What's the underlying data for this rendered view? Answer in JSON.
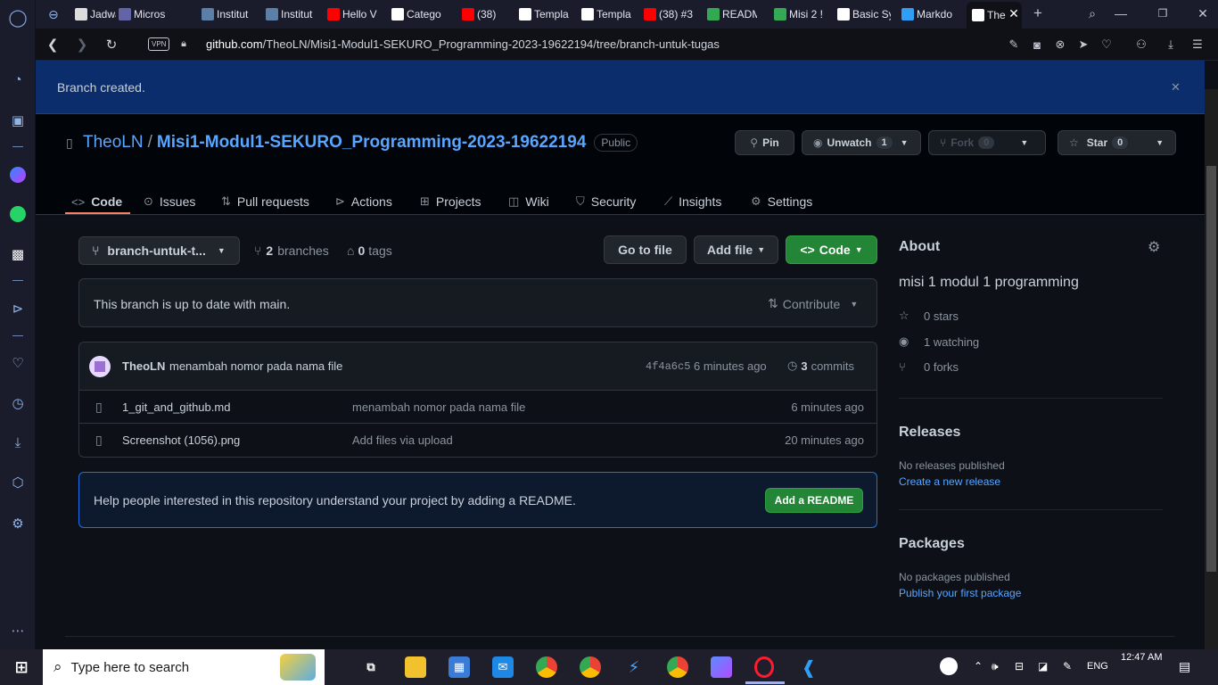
{
  "browser": {
    "tabs": [
      {
        "label": "Jadwal",
        "favicon": "notebook-icon"
      },
      {
        "label": "Micros",
        "favicon": "teams-icon"
      },
      {
        "label": "Institut",
        "favicon": "tableau-icon"
      },
      {
        "label": "Institut",
        "favicon": "tableau-icon"
      },
      {
        "label": "Hello V",
        "favicon": "youtube-icon"
      },
      {
        "label": "Catego",
        "favicon": "s-icon"
      },
      {
        "label": "(38)",
        "favicon": "youtube-icon"
      },
      {
        "label": "Templa",
        "favicon": "github-icon"
      },
      {
        "label": "Templa",
        "favicon": "github-icon"
      },
      {
        "label": "(38) #3",
        "favicon": "youtube-icon"
      },
      {
        "label": "READM",
        "favicon": "drive-icon"
      },
      {
        "label": "Misi 2 !",
        "favicon": "drive-icon"
      },
      {
        "label": "Basic Sy",
        "favicon": "md-icon"
      },
      {
        "label": "Markdo",
        "favicon": "vscode-icon"
      },
      {
        "label": "The",
        "favicon": "github-icon"
      }
    ],
    "vpn_label": "VPN",
    "url_host": "github.com",
    "url_path": "/TheoLN/Misi1-Modul1-SEKURO_Programming-2023-19622194/tree/branch-untuk-tugas"
  },
  "flash": {
    "text": "Branch created."
  },
  "repo": {
    "owner": "TheoLN",
    "separator": "/",
    "name": "Misi1-Modul1-SEKURO_Programming-2023-19622194",
    "visibility": "Public",
    "pin_label": "Pin",
    "unwatch_label": "Unwatch",
    "watch_count": "1",
    "fork_label": "Fork",
    "fork_count": "0",
    "star_label": "Star",
    "star_count": "0"
  },
  "reponav": [
    {
      "label": "Code",
      "icon": "code-icon"
    },
    {
      "label": "Issues",
      "icon": "issue-icon"
    },
    {
      "label": "Pull requests",
      "icon": "pull-request-icon"
    },
    {
      "label": "Actions",
      "icon": "play-icon"
    },
    {
      "label": "Projects",
      "icon": "table-icon"
    },
    {
      "label": "Wiki",
      "icon": "book-icon"
    },
    {
      "label": "Security",
      "icon": "shield-icon"
    },
    {
      "label": "Insights",
      "icon": "graph-icon"
    },
    {
      "label": "Settings",
      "icon": "gear-icon"
    }
  ],
  "toolbar": {
    "branch": "branch-untuk-t...",
    "branches_count": "2",
    "branches_label": "branches",
    "tags_count": "0",
    "tags_label": "tags",
    "go_to_file": "Go to file",
    "add_file": "Add file",
    "code": "Code"
  },
  "branch_status": {
    "text": "This branch is up to date with main.",
    "contribute": "Contribute"
  },
  "latest_commit": {
    "author": "TheoLN",
    "message": "menambah nomor pada nama file",
    "sha": "4f4a6c5",
    "time": "6 minutes ago",
    "commits_count": "3",
    "commits_label": "commits"
  },
  "files": [
    {
      "name": "1_git_and_github.md",
      "message": "menambah nomor pada nama file",
      "time": "6 minutes ago"
    },
    {
      "name": "Screenshot (1056).png",
      "message": "Add files via upload",
      "time": "20 minutes ago"
    }
  ],
  "readme_prompt": {
    "text": "Help people interested in this repository understand your project by adding a README.",
    "button": "Add a README"
  },
  "about": {
    "heading": "About",
    "description": "misi 1 modul 1 programming",
    "stars": "0 stars",
    "watching": "1 watching",
    "forks": "0 forks"
  },
  "releases": {
    "heading": "Releases",
    "empty": "No releases published",
    "link": "Create a new release"
  },
  "packages": {
    "heading": "Packages",
    "empty": "No packages published",
    "link": "Publish your first package"
  },
  "taskbar": {
    "search_placeholder": "Type here to search",
    "clock_time": "12:47 AM",
    "language": "ENG"
  },
  "colors": {
    "accent_blue": "#58a6ff",
    "button_green": "#238636",
    "underline_orange": "#f78166",
    "flash_bg": "#0c2d6b"
  }
}
